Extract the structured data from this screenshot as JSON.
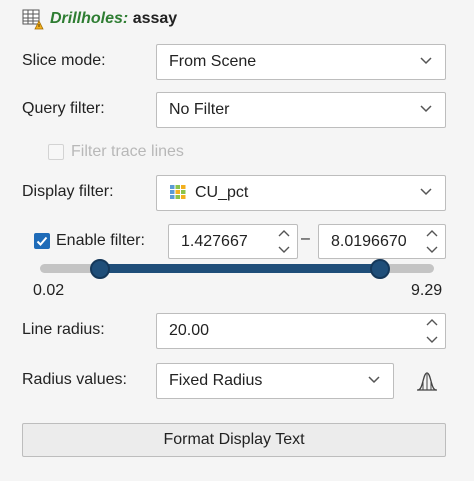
{
  "header": {
    "title_prefix": "Drillholes:",
    "title_suffix": "assay",
    "icon": "drillhole-table-icon"
  },
  "fields": {
    "slice_mode": {
      "label": "Slice mode:",
      "value": "From Scene"
    },
    "query_filter": {
      "label": "Query filter:",
      "value": "No Filter"
    },
    "filter_trace_lines": {
      "label": "Filter trace lines",
      "checked": false,
      "enabled": false
    },
    "display_filter": {
      "label": "Display filter:",
      "value": "CU_pct",
      "icon": "column-table-icon"
    },
    "enable_filter": {
      "label": "Enable filter:",
      "checked": true,
      "min_value": "1.427667",
      "max_value": "8.0196670",
      "separator": "–"
    },
    "range": {
      "min_label": "0.02",
      "max_label": "9.29",
      "low_fraction": 0.153,
      "high_fraction": 0.862
    },
    "line_radius": {
      "label": "Line radius:",
      "value": "20.00"
    },
    "radius_values": {
      "label": "Radius values:",
      "value": "Fixed Radius",
      "dist_icon": "distribution-icon"
    }
  },
  "buttons": {
    "format_display_text": "Format Display Text"
  },
  "colors": {
    "accent": "#1f4e79",
    "checkbox": "#1e6bb8",
    "title_green": "#2e7d32"
  }
}
